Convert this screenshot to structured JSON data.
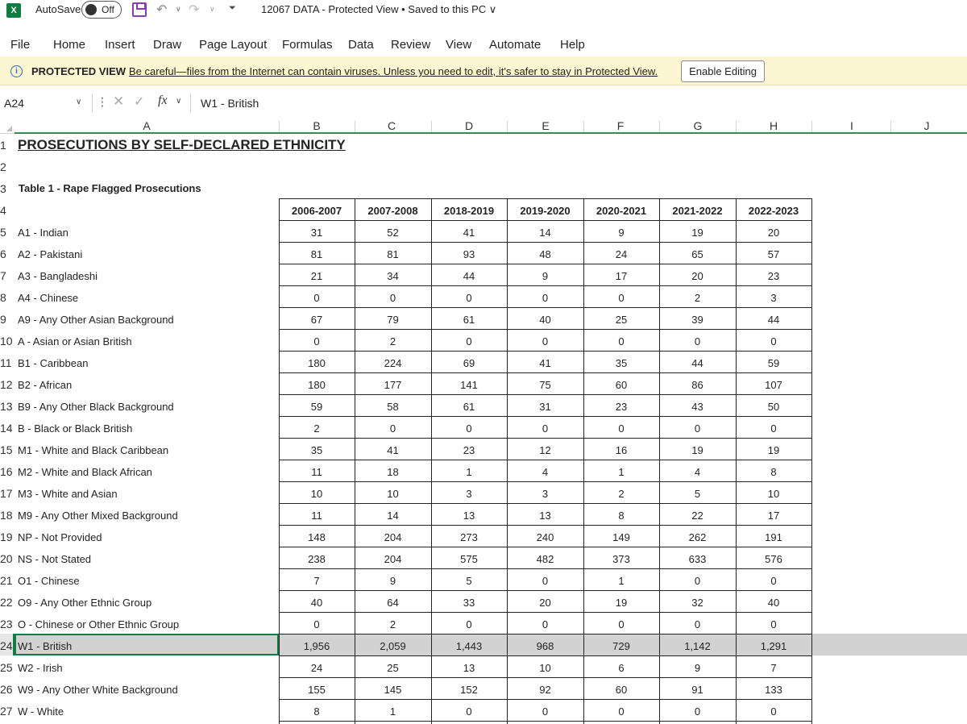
{
  "titlebar": {
    "autosave_label": "AutoSave",
    "autosave_state": "Off",
    "doc_title": "12067 DATA  -  Protected View  •  Saved to this PC ∨",
    "app_icon": "excel-icon"
  },
  "menu": [
    "File",
    "Home",
    "Insert",
    "Draw",
    "Page Layout",
    "Formulas",
    "Data",
    "Review",
    "View",
    "Automate",
    "Help"
  ],
  "protected_view": {
    "title": "PROTECTED VIEW",
    "message": "Be careful—files from the Internet can contain viruses. Unless you need to edit, it's safer to stay in Protected View.",
    "button": "Enable Editing"
  },
  "formula_bar": {
    "name_box": "A24",
    "fx": "fx",
    "content": "W1 - British"
  },
  "columns": [
    "A",
    "B",
    "C",
    "D",
    "E",
    "F",
    "G",
    "H",
    "I",
    "J"
  ],
  "sheet": {
    "title": "PROSECUTIONS BY SELF-DECLARED ETHNICITY",
    "table_label": "Table 1 - Rape Flagged Prosecutions",
    "headers": [
      "2006-2007",
      "2007-2008",
      "2018-2019",
      "2019-2020",
      "2020-2021",
      "2021-2022",
      "2022-2023"
    ],
    "rows": [
      {
        "label": "A1 - Indian",
        "values": [
          "31",
          "52",
          "41",
          "14",
          "9",
          "19",
          "20"
        ]
      },
      {
        "label": "A2 - Pakistani",
        "values": [
          "81",
          "81",
          "93",
          "48",
          "24",
          "65",
          "57"
        ]
      },
      {
        "label": "A3 - Bangladeshi",
        "values": [
          "21",
          "34",
          "44",
          "9",
          "17",
          "20",
          "23"
        ]
      },
      {
        "label": "A4 - Chinese",
        "values": [
          "0",
          "0",
          "0",
          "0",
          "0",
          "2",
          "3"
        ]
      },
      {
        "label": "A9 - Any Other Asian Background",
        "values": [
          "67",
          "79",
          "61",
          "40",
          "25",
          "39",
          "44"
        ]
      },
      {
        "label": "A - Asian or Asian British",
        "values": [
          "0",
          "2",
          "0",
          "0",
          "0",
          "0",
          "0"
        ]
      },
      {
        "label": "B1 - Caribbean",
        "values": [
          "180",
          "224",
          "69",
          "41",
          "35",
          "44",
          "59"
        ]
      },
      {
        "label": "B2 - African",
        "values": [
          "180",
          "177",
          "141",
          "75",
          "60",
          "86",
          "107"
        ]
      },
      {
        "label": "B9 - Any Other Black Background",
        "values": [
          "59",
          "58",
          "61",
          "31",
          "23",
          "43",
          "50"
        ]
      },
      {
        "label": "B - Black or Black British",
        "values": [
          "2",
          "0",
          "0",
          "0",
          "0",
          "0",
          "0"
        ]
      },
      {
        "label": "M1 - White and Black Caribbean",
        "values": [
          "35",
          "41",
          "23",
          "12",
          "16",
          "19",
          "19"
        ]
      },
      {
        "label": "M2 - White and Black African",
        "values": [
          "11",
          "18",
          "1",
          "4",
          "1",
          "4",
          "8"
        ]
      },
      {
        "label": "M3 - White and Asian",
        "values": [
          "10",
          "10",
          "3",
          "3",
          "2",
          "5",
          "10"
        ]
      },
      {
        "label": "M9 - Any Other Mixed Background",
        "values": [
          "11",
          "14",
          "13",
          "13",
          "8",
          "22",
          "17"
        ]
      },
      {
        "label": "NP - Not Provided",
        "values": [
          "148",
          "204",
          "273",
          "240",
          "149",
          "262",
          "191"
        ]
      },
      {
        "label": "NS - Not Stated",
        "values": [
          "238",
          "204",
          "575",
          "482",
          "373",
          "633",
          "576"
        ]
      },
      {
        "label": "O1 - Chinese",
        "values": [
          "7",
          "9",
          "5",
          "0",
          "1",
          "0",
          "0"
        ]
      },
      {
        "label": "O9 - Any Other Ethnic Group",
        "values": [
          "40",
          "64",
          "33",
          "20",
          "19",
          "32",
          "40"
        ]
      },
      {
        "label": "O - Chinese or Other Ethnic Group",
        "values": [
          "0",
          "2",
          "0",
          "0",
          "0",
          "0",
          "0"
        ]
      },
      {
        "label": "W1 - British",
        "values": [
          "1,956",
          "2,059",
          "1,443",
          "968",
          "729",
          "1,142",
          "1,291"
        ]
      },
      {
        "label": "W2 - Irish",
        "values": [
          "24",
          "25",
          "13",
          "10",
          "6",
          "9",
          "7"
        ]
      },
      {
        "label": "W9 - Any Other White Background",
        "values": [
          "155",
          "145",
          "152",
          "92",
          "60",
          "91",
          "133"
        ]
      },
      {
        "label": "W - White",
        "values": [
          "8",
          "1",
          "0",
          "0",
          "0",
          "0",
          "0"
        ]
      }
    ]
  },
  "row_numbers": [
    "1",
    "2",
    "3",
    "4",
    "5",
    "6",
    "7",
    "8",
    "9",
    "10",
    "11",
    "12",
    "13",
    "14",
    "15",
    "16",
    "17",
    "18",
    "19",
    "20",
    "21",
    "22",
    "23",
    "24",
    "25",
    "26",
    "27"
  ],
  "selected_row": "24",
  "colors": {
    "accent": "#107c41",
    "protected_bar": "#fdf6d2",
    "selected_row": "#d2d2d2"
  }
}
